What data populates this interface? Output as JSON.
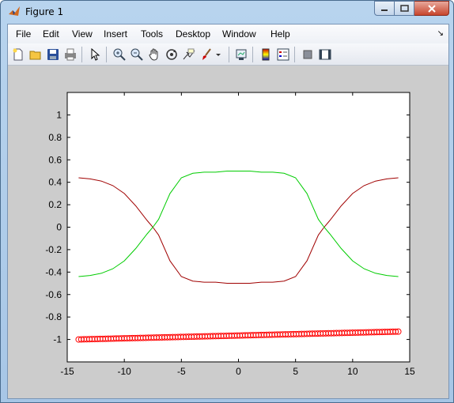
{
  "window": {
    "title": "Figure 1"
  },
  "menu": [
    "File",
    "Edit",
    "View",
    "Insert",
    "Tools",
    "Desktop",
    "Window",
    "Help"
  ],
  "toolbar": {
    "icons": [
      "new-figure-icon",
      "open-file-icon",
      "save-icon",
      "print-icon",
      "edit-plot-icon",
      "zoom-in-icon",
      "zoom-out-icon",
      "pan-icon",
      "rotate-3d-icon",
      "data-cursor-icon",
      "brush-icon",
      "link-plot-icon",
      "colorbar-icon",
      "legend-icon",
      "hide-plot-tools-icon",
      "show-plot-tools-icon"
    ]
  },
  "chart_data": {
    "type": "line",
    "xlim": [
      -15,
      15
    ],
    "ylim": [
      -1.2,
      1.2
    ],
    "xticks": [
      "-15",
      "-10",
      "-5",
      "0",
      "5",
      "10",
      "15"
    ],
    "yticks": [
      "1",
      "0.8",
      "0.6",
      "0.4",
      "0.2",
      "0",
      "-0.2",
      "-0.4",
      "-0.6",
      "-0.8",
      "-1"
    ],
    "grid": false,
    "colors": {
      "red": "#a00000",
      "green": "#00cc00",
      "markers": "#ff0000"
    },
    "series": [
      {
        "color": "#a00000",
        "style": "line",
        "x": [
          -14,
          -13,
          -12,
          -11,
          -10,
          -9,
          -8,
          -7.5,
          -7,
          -6,
          -5,
          -4,
          -3,
          -2,
          -1,
          0,
          1,
          2,
          3,
          4,
          5,
          6,
          7,
          7.5,
          8,
          9,
          10,
          11,
          12,
          13,
          14
        ],
        "y": [
          0.44,
          0.43,
          0.41,
          0.37,
          0.3,
          0.19,
          0.06,
          0.0,
          -0.07,
          -0.3,
          -0.44,
          -0.48,
          -0.49,
          -0.49,
          -0.5,
          -0.5,
          -0.5,
          -0.49,
          -0.49,
          -0.48,
          -0.44,
          -0.3,
          -0.07,
          0.0,
          0.06,
          0.19,
          0.3,
          0.37,
          0.41,
          0.43,
          0.44
        ]
      },
      {
        "color": "#00cc00",
        "style": "line",
        "x": [
          -14,
          -13,
          -12,
          -11,
          -10,
          -9,
          -8,
          -7.5,
          -7,
          -6,
          -5,
          -4,
          -3,
          -2,
          -1,
          0,
          1,
          2,
          3,
          4,
          5,
          6,
          7,
          7.5,
          8,
          9,
          10,
          11,
          12,
          13,
          14
        ],
        "y": [
          -0.44,
          -0.43,
          -0.41,
          -0.37,
          -0.3,
          -0.19,
          -0.06,
          0.0,
          0.07,
          0.3,
          0.44,
          0.48,
          0.49,
          0.49,
          0.5,
          0.5,
          0.5,
          0.49,
          0.49,
          0.48,
          0.44,
          0.3,
          0.07,
          0.0,
          -0.06,
          -0.19,
          -0.3,
          -0.37,
          -0.41,
          -0.43,
          -0.44
        ]
      },
      {
        "color": "#ff0000",
        "style": "markers-circle",
        "x_start": -14,
        "x_end": 14,
        "y_start": -1.0,
        "y_end": -0.93,
        "count": 120
      }
    ]
  }
}
